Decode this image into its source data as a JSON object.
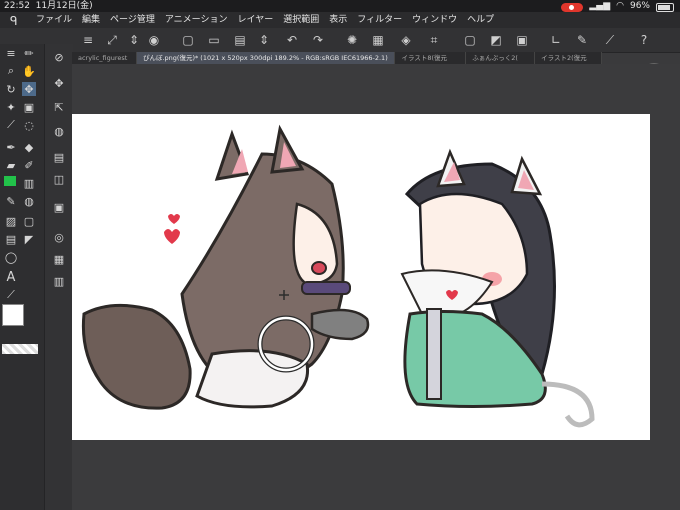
{
  "status": {
    "time": "22:52",
    "date": "11月12日(金)",
    "battery": "96%"
  },
  "menu": [
    "ファイル",
    "編集",
    "ページ管理",
    "アニメーション",
    "レイヤー",
    "選択範囲",
    "表示",
    "フィルター",
    "ウィンドウ",
    "ヘルプ"
  ],
  "tabs": [
    {
      "label": "acrylic_figurest"
    },
    {
      "label": "ぴんぼ.png(復元)* (1021 x 520px 300dpi 189.2% - RGB:sRGB IEC61966-2.1)"
    },
    {
      "label": "イラスト8(復元"
    },
    {
      "label": "ふぁんぷっく2("
    },
    {
      "label": "イラスト2(復元"
    }
  ],
  "icons": {
    "app_logo": "clip-studio-logo-icon",
    "next": "chevron-right-icon"
  },
  "colors": {
    "main_color": "#ffffff",
    "green_swatch": "#22c24a",
    "cursor_ring": "#ffffff"
  }
}
